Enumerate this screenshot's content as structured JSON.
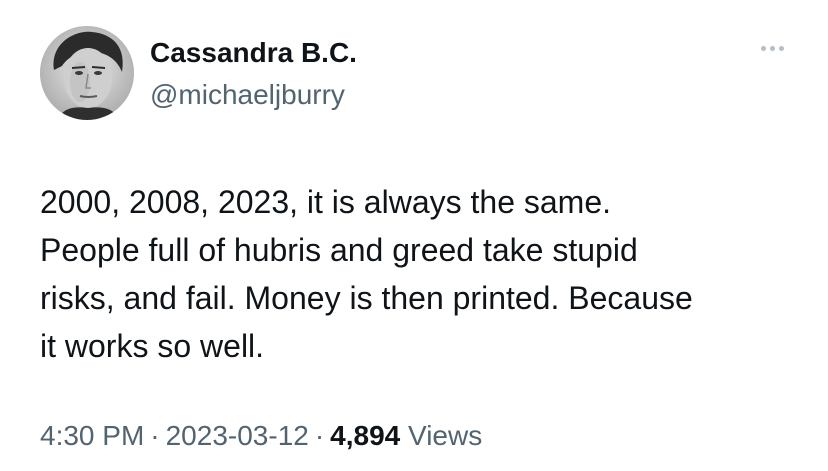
{
  "author": {
    "display_name": "Cassandra B.C.",
    "handle": "@michaeljburry",
    "avatar_icon": "profile-photo"
  },
  "more_icon": "more-horizontal-icon",
  "tweet": {
    "text_lines": [
      "2000, 2008, 2023, it is always the same.",
      "People full of hubris and greed take stupid",
      "risks, and fail. Money is then printed. Because",
      "it works so well."
    ]
  },
  "meta": {
    "time": "4:30 PM",
    "separator": "·",
    "date": "2023-03-12",
    "views_count": "4,894",
    "views_label": "Views"
  },
  "colors": {
    "primary_text": "#0f1419",
    "secondary_text": "#536471",
    "more_dots": "#b4bec7"
  }
}
